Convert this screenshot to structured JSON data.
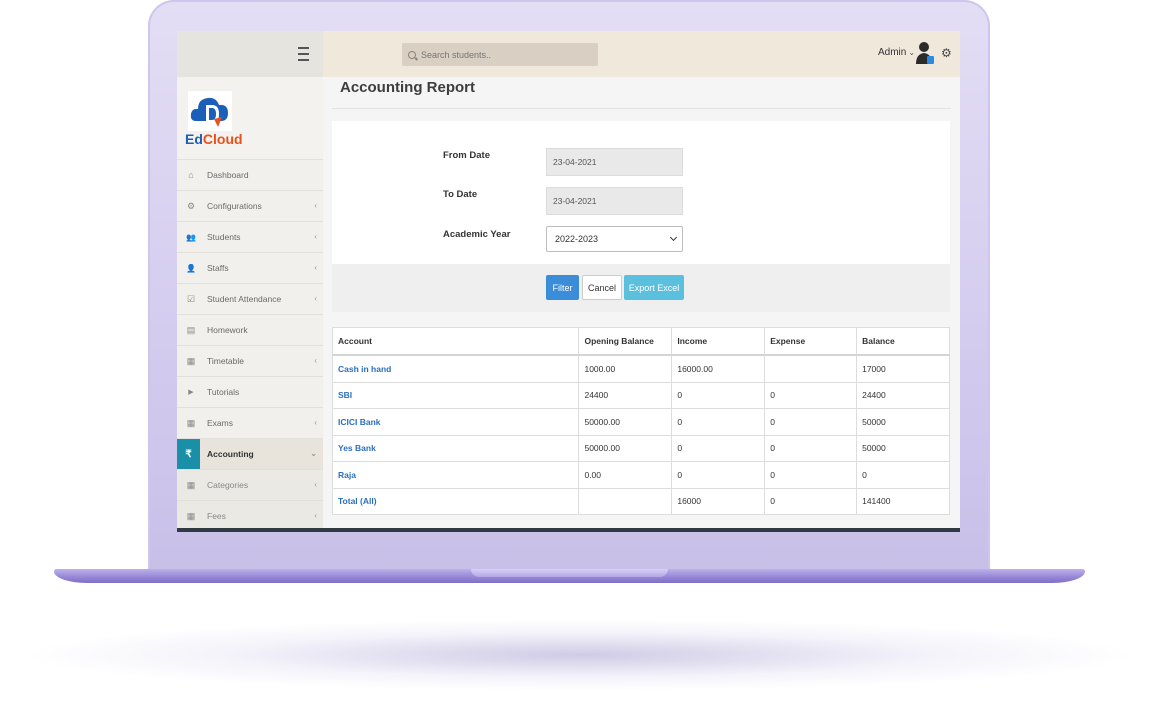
{
  "topbar": {
    "search_placeholder": "Search students..",
    "user_name": "Admin",
    "user_chevron": "⌄",
    "gear_symbol": "⚙"
  },
  "brand": {
    "logo_text_1": "Ed",
    "logo_text_2": "Cloud",
    "color_1": "#1c5fb8",
    "color_2": "#e8501c"
  },
  "sidebar": {
    "items": [
      {
        "label": "Dashboard",
        "icon": "dashboard-icon",
        "glyph": "⌂",
        "chevron": ""
      },
      {
        "label": "Configurations",
        "icon": "cogs-icon",
        "glyph": "⚙",
        "chevron": "‹"
      },
      {
        "label": "Students",
        "icon": "users-icon",
        "glyph": "👥",
        "chevron": "‹"
      },
      {
        "label": "Staffs",
        "icon": "user-icon",
        "glyph": "👤",
        "chevron": "‹"
      },
      {
        "label": "Student Attendance",
        "icon": "check-square-icon",
        "glyph": "☑",
        "chevron": "‹"
      },
      {
        "label": "Homework",
        "icon": "file-icon",
        "glyph": "▤",
        "chevron": ""
      },
      {
        "label": "Timetable",
        "icon": "table-icon",
        "glyph": "▦",
        "chevron": "‹"
      },
      {
        "label": "Tutorials",
        "icon": "youtube-icon",
        "glyph": "▶",
        "chevron": ""
      },
      {
        "label": "Exams",
        "icon": "grid-icon",
        "glyph": "▦",
        "chevron": "‹"
      },
      {
        "label": "Accounting",
        "icon": "rupee-icon",
        "glyph": "₹",
        "chevron": "⌄",
        "active": true
      },
      {
        "label": "Categories",
        "icon": "table-icon",
        "glyph": "▦",
        "chevron": "‹",
        "sub": true
      },
      {
        "label": "Fees",
        "icon": "table-icon",
        "glyph": "▦",
        "chevron": "‹",
        "sub": true
      }
    ]
  },
  "page": {
    "title": "Accounting Report"
  },
  "form": {
    "from_date_label": "From Date",
    "from_date_value": "23-04-2021",
    "to_date_label": "To Date",
    "to_date_value": "23-04-2021",
    "academic_year_label": "Academic Year",
    "academic_year_value": "2022-2023"
  },
  "buttons": {
    "filter": "Filter",
    "cancel": "Cancel",
    "export": "Export Excel"
  },
  "table": {
    "headers": [
      "Account",
      "Opening Balance",
      "Income",
      "Expense",
      "Balance"
    ],
    "rows": [
      [
        "Cash in hand",
        "1000.00",
        "16000.00",
        "",
        "17000"
      ],
      [
        "SBI",
        "24400",
        "0",
        "0",
        "24400"
      ],
      [
        "ICICI Bank",
        "50000.00",
        "0",
        "0",
        "50000"
      ],
      [
        "Yes Bank",
        "50000.00",
        "0",
        "0",
        "50000"
      ],
      [
        "Raja",
        "0.00",
        "0",
        "0",
        "0"
      ],
      [
        "Total (All)",
        "",
        "16000",
        "0",
        "141400"
      ]
    ]
  }
}
